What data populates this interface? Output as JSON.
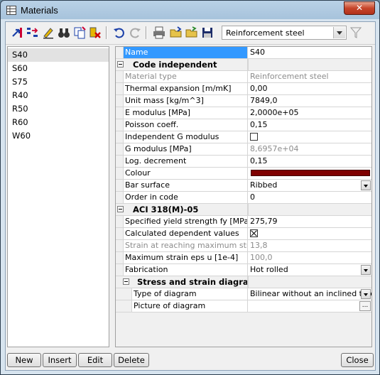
{
  "window": {
    "title": "Materials",
    "close_glyph": "✕"
  },
  "toolbar": {
    "icons": [
      "import-icon",
      "transfer-icon",
      "edit-pencil-icon",
      "binoculars-icon",
      "copy-icon",
      "delete-icon",
      "undo-icon",
      "redo-icon",
      "print-icon",
      "open-folder-icon",
      "open-folder2-icon",
      "save-icon",
      "filter-icon"
    ],
    "material_type": "Reinforcement steel"
  },
  "materials": [
    "S40",
    "S60",
    "S75",
    "R40",
    "R50",
    "R60",
    "W60"
  ],
  "selected_material": "S40",
  "props": {
    "name": {
      "label": "Name",
      "value": "S40"
    },
    "section_code": "Code independent",
    "material_type": {
      "label": "Material type",
      "value": "Reinforcement steel"
    },
    "thermal": {
      "label": "Thermal expansion  [m/mK]",
      "value": "0,00"
    },
    "unit_mass": {
      "label": "Unit mass [kg/m^3]",
      "value": "7849,0"
    },
    "e_modulus": {
      "label": "E modulus [MPa]",
      "value": "2,0000e+05"
    },
    "poisson": {
      "label": "Poisson coeff.",
      "value": "0,15"
    },
    "indep_g": {
      "label": "Independent G modulus",
      "checked": false
    },
    "g_modulus": {
      "label": "G modulus [MPa]",
      "value": "8,6957e+04"
    },
    "log_decrement": {
      "label": "Log. decrement",
      "value": "0,15"
    },
    "colour": {
      "label": "Colour",
      "color": "#7f0000"
    },
    "bar_surface": {
      "label": "Bar surface",
      "value": "Ribbed"
    },
    "order": {
      "label": "Order in code",
      "value": "0"
    },
    "section_aci": "ACI 318(M)-05",
    "fy": {
      "label": "Specified yield strength fy  [MPa]",
      "value": "275,79"
    },
    "calc_dep": {
      "label": "Calculated dependent values",
      "checked": true
    },
    "strain_max": {
      "label": "Strain at reaching maximum streng...",
      "value": "13,8"
    },
    "max_strain": {
      "label": "Maximum strain eps u  [1e-4]",
      "value": "100,0"
    },
    "fabrication": {
      "label": "Fabrication",
      "value": "Hot rolled"
    },
    "section_stress": "Stress and strain diagram",
    "diagram_type": {
      "label": "Type of diagram",
      "value": "Bilinear without an inclined top bra"
    },
    "diagram_picture": {
      "label": "Picture of diagram",
      "button": "..."
    }
  },
  "buttons": {
    "new": "New",
    "insert": "Insert",
    "edit": "Edit",
    "delete": "Delete",
    "close": "Close"
  }
}
